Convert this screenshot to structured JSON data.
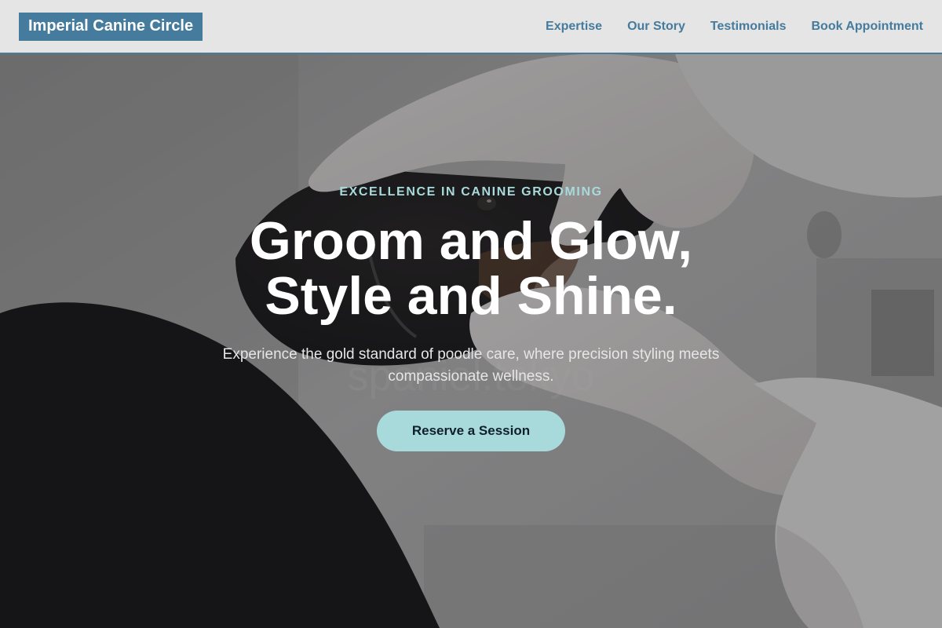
{
  "header": {
    "logo": "Imperial Canine Circle",
    "nav": [
      {
        "label": "Expertise"
      },
      {
        "label": "Our Story"
      },
      {
        "label": "Testimonials"
      },
      {
        "label": "Book Appointment"
      }
    ]
  },
  "hero": {
    "eyebrow": "EXCELLENCE IN CANINE GROOMING",
    "headline_line1": "Groom and Glow,",
    "headline_line2": "Style and Shine.",
    "subtext": "Experience the gold standard of poodle care, where precision styling meets compassionate wellness.",
    "cta": "Reserve a Session",
    "photo_watermark": "spaniel.tokyo"
  },
  "colors": {
    "brand": "#457b9d",
    "accent": "#a8dadc",
    "header_bg": "#e5e5e5"
  }
}
